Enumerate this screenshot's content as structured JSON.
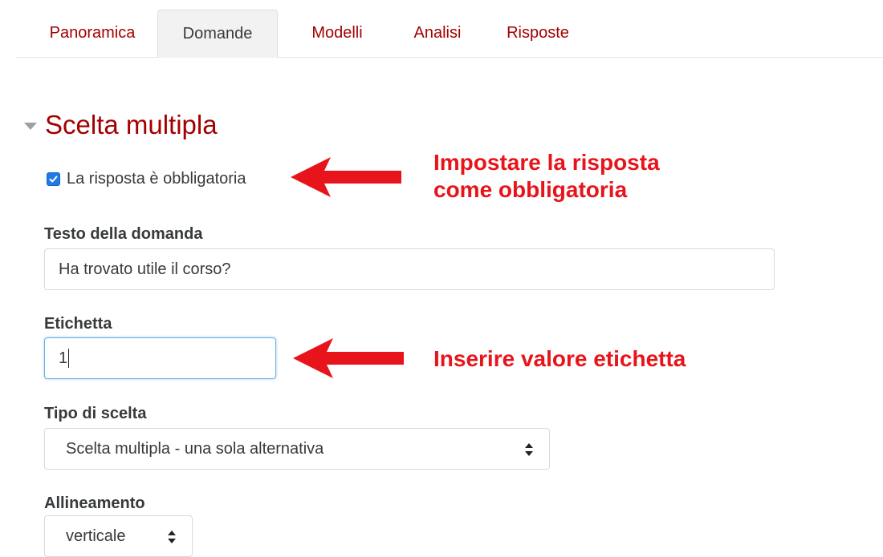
{
  "tabs": [
    {
      "label": "Panoramica",
      "active": false
    },
    {
      "label": "Domande",
      "active": true
    },
    {
      "label": "Modelli",
      "active": false
    },
    {
      "label": "Analisi",
      "active": false
    },
    {
      "label": "Risposte",
      "active": false
    }
  ],
  "section": {
    "title": "Scelta multipla",
    "collapse_icon": "triangle-down-icon"
  },
  "required_checkbox": {
    "label": "La risposta è obbligatoria",
    "checked": true
  },
  "question_text": {
    "label": "Testo della domanda",
    "value": "Ha trovato utile il corso?"
  },
  "label_field": {
    "label": "Etichetta",
    "value": "1"
  },
  "choice_type": {
    "label": "Tipo di scelta",
    "selected": "Scelta multipla - una sola alternativa"
  },
  "alignment": {
    "label": "Allineamento",
    "selected": "verticale"
  },
  "annotations": {
    "required_line1": "Impostare la risposta",
    "required_line2": "come obbligatoria",
    "label_note": "Inserire valore etichetta"
  },
  "colors": {
    "accent": "#a30000",
    "annotation": "#e8141b",
    "checkbox": "#1f7ae6"
  }
}
